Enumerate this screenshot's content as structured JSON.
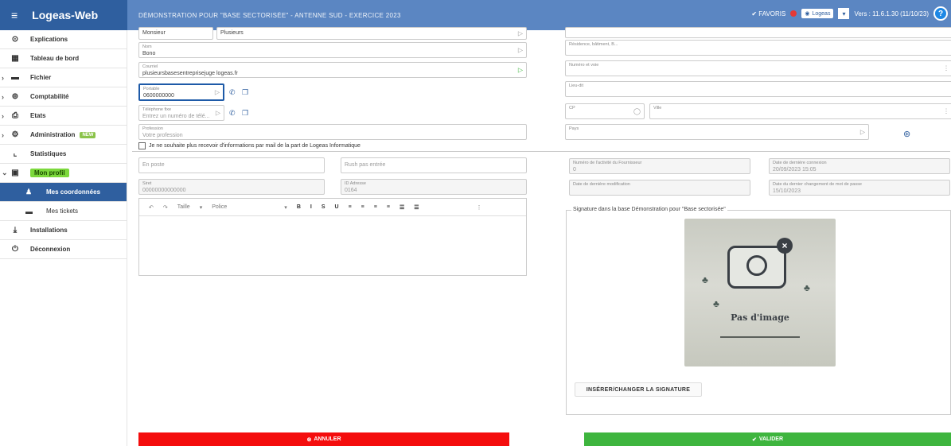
{
  "app": {
    "title": "Logeas-Web",
    "context": "DÉMONSTRATION POUR \"BASE SECTORISÉE\" - ANTENNE SUD - EXERCICE 2023",
    "actions_label": "✔ FAVORIS",
    "logo_label": "Logeas",
    "version": "Vers : 11.6.1.30 (11/10/23)",
    "help": "?"
  },
  "sidebar": {
    "items": [
      {
        "label": "Explications",
        "icon": "circle-question-icon"
      },
      {
        "label": "Tableau de bord",
        "icon": "grid-icon"
      },
      {
        "label": "Fichier",
        "icon": "folder-icon"
      },
      {
        "label": "Comptabilité",
        "icon": "calculator-icon"
      },
      {
        "label": "Etats",
        "icon": "print-icon"
      },
      {
        "label": "Administration",
        "icon": "gear-icon",
        "badge": "NEW"
      },
      {
        "label": "Statistiques",
        "icon": "chart-icon"
      },
      {
        "label": "Mon profil",
        "icon": "profile-icon"
      },
      {
        "label": "Mes coordonnées",
        "icon": "user-icon"
      },
      {
        "label": "Mes tickets",
        "icon": "ticket-icon"
      },
      {
        "label": "Installations",
        "icon": "download-icon"
      },
      {
        "label": "Déconnexion",
        "icon": "power-icon"
      }
    ]
  },
  "form": {
    "civility": "Monsieur",
    "firstname": "Plusieurs",
    "name_label": "Nom",
    "name": "Bono",
    "email_label": "Courriel",
    "email": "plusieursbasesentreprisejuge logeas.fr",
    "phone_label": "Portable",
    "phone": "0600000000",
    "phone2_label": "Téléphone fixe",
    "phone2_placeholder": "Entrez un numéro de télé...",
    "profession_label": "Profession",
    "profession": "Votre profession",
    "newsletter": "Je ne souhaite plus recevoir d'informations par mail de la part de Logeas Informatique",
    "date_field": "En poste",
    "id_field": "Rush pas entrée",
    "siret_label": "Siret",
    "siret": "00000000000000",
    "naf_label": "ID Adresse",
    "naf": "0164"
  },
  "editor": {
    "font": "Taille",
    "style": "Police",
    "buttons": [
      "B",
      "I",
      "S",
      "U",
      "≡",
      "≡",
      "≡",
      "≡",
      "☰",
      "☰"
    ]
  },
  "address": {
    "line1_label": "Résidence, bâtiment, B...",
    "line2_label": "Numéro et voie",
    "line3_label": "Lieu-dit",
    "cp_label": "CP",
    "city_label": "Ville",
    "country_label": "Pays"
  },
  "meta": {
    "created_label": "Numéro de l'activité du Fournisseur",
    "created_val": "0",
    "last_conn_label": "Date de dernière connexion",
    "last_conn_val": "20/09/2023 15:05",
    "last_mod_label": "Date de dernière modification",
    "last_pwd_label": "Date du dernier changement de mot de passe",
    "last_pwd_val": "15/10/2023"
  },
  "signature": {
    "title": "Signature dans la base Démonstration pour \"Base sectorisée\"",
    "noimage": "Pas d'image",
    "button": "INSÉRER/CHANGER LA SIGNATURE"
  },
  "buttons": {
    "cancel": "ANNULER",
    "validate": "VALIDER"
  }
}
